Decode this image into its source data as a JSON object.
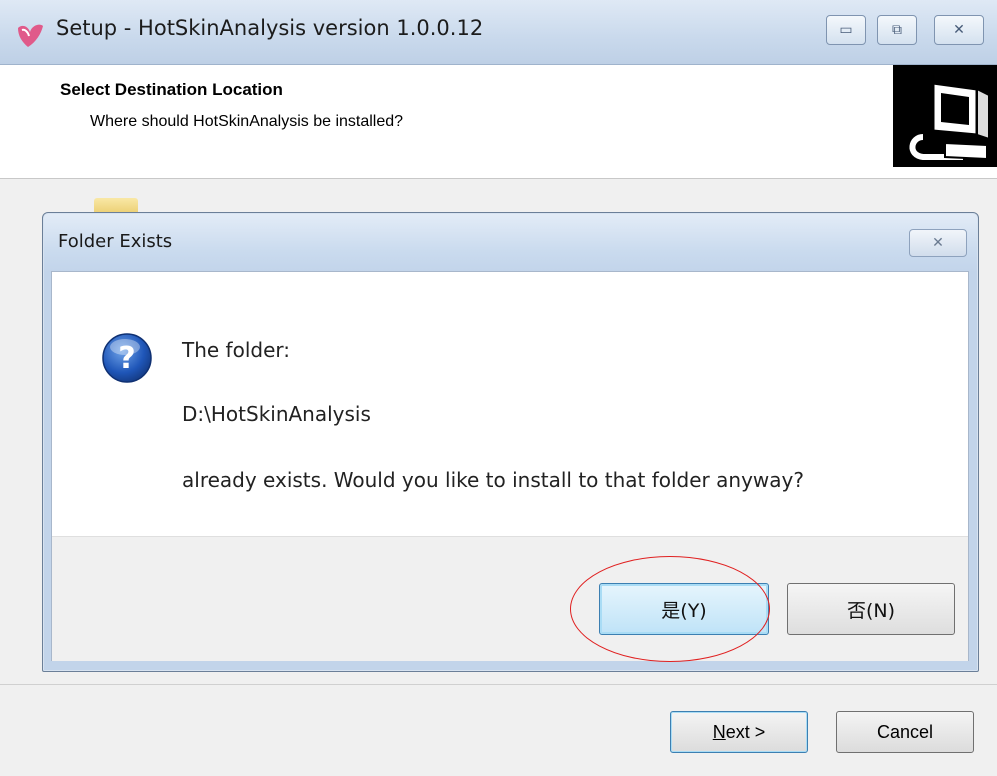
{
  "window": {
    "title": "Setup - HotSkinAnalysis version 1.0.0.12",
    "icon": "app-logo-icon",
    "minimize_glyph": "▭",
    "maximize_glyph": "⧉",
    "close_glyph": "✕"
  },
  "header": {
    "title": "Select Destination Location",
    "subtitle": "Where should HotSkinAnalysis be installed?",
    "image": "computer-install-icon"
  },
  "dialog": {
    "title": "Folder Exists",
    "close_glyph": "✕",
    "icon": "question-icon",
    "line1": "The folder:",
    "line2": "D:\\HotSkinAnalysis",
    "line3": "already exists. Would you like to install to that folder anyway?",
    "yes_label": "是(Y)",
    "no_label": "否(N)"
  },
  "buttons": {
    "next_accel": "N",
    "next_rest": "ext >",
    "cancel": "Cancel"
  },
  "colors": {
    "annotation": "#e02020",
    "accent_border": "#3c7fb1"
  }
}
